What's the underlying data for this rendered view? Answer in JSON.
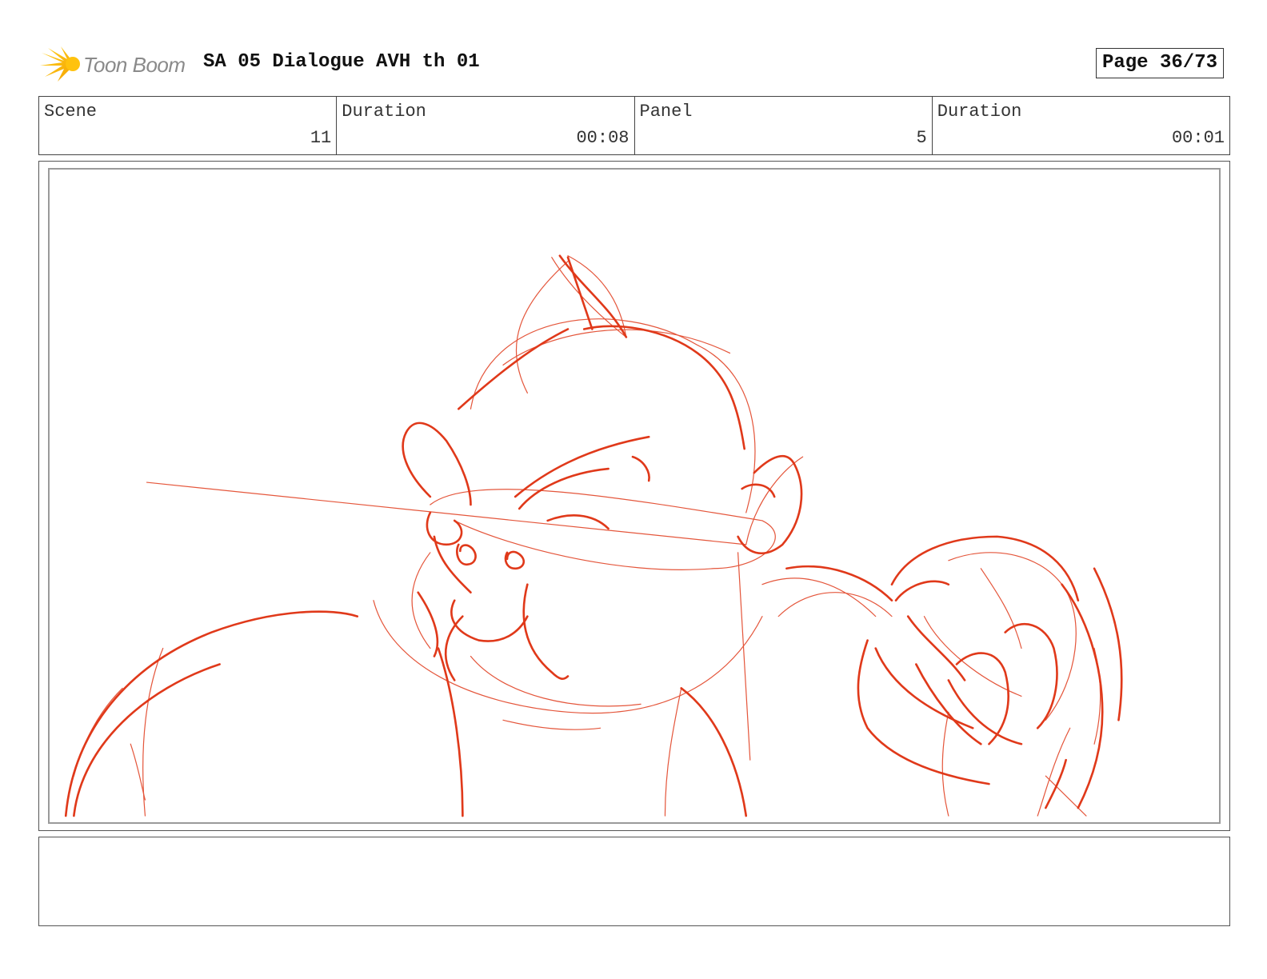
{
  "header": {
    "logo_text": "Toon Boom",
    "title": "SA 05 Dialogue AVH th 01",
    "page_label": "Page 36/73"
  },
  "info": {
    "scene_label": "Scene",
    "scene_value": "11",
    "scene_duration_label": "Duration",
    "scene_duration_value": "00:08",
    "panel_label": "Panel",
    "panel_value": "5",
    "panel_duration_label": "Duration",
    "panel_duration_value": "00:01"
  },
  "panel": {
    "sketch_color": "#e0391a"
  },
  "notes": {
    "text": ""
  }
}
